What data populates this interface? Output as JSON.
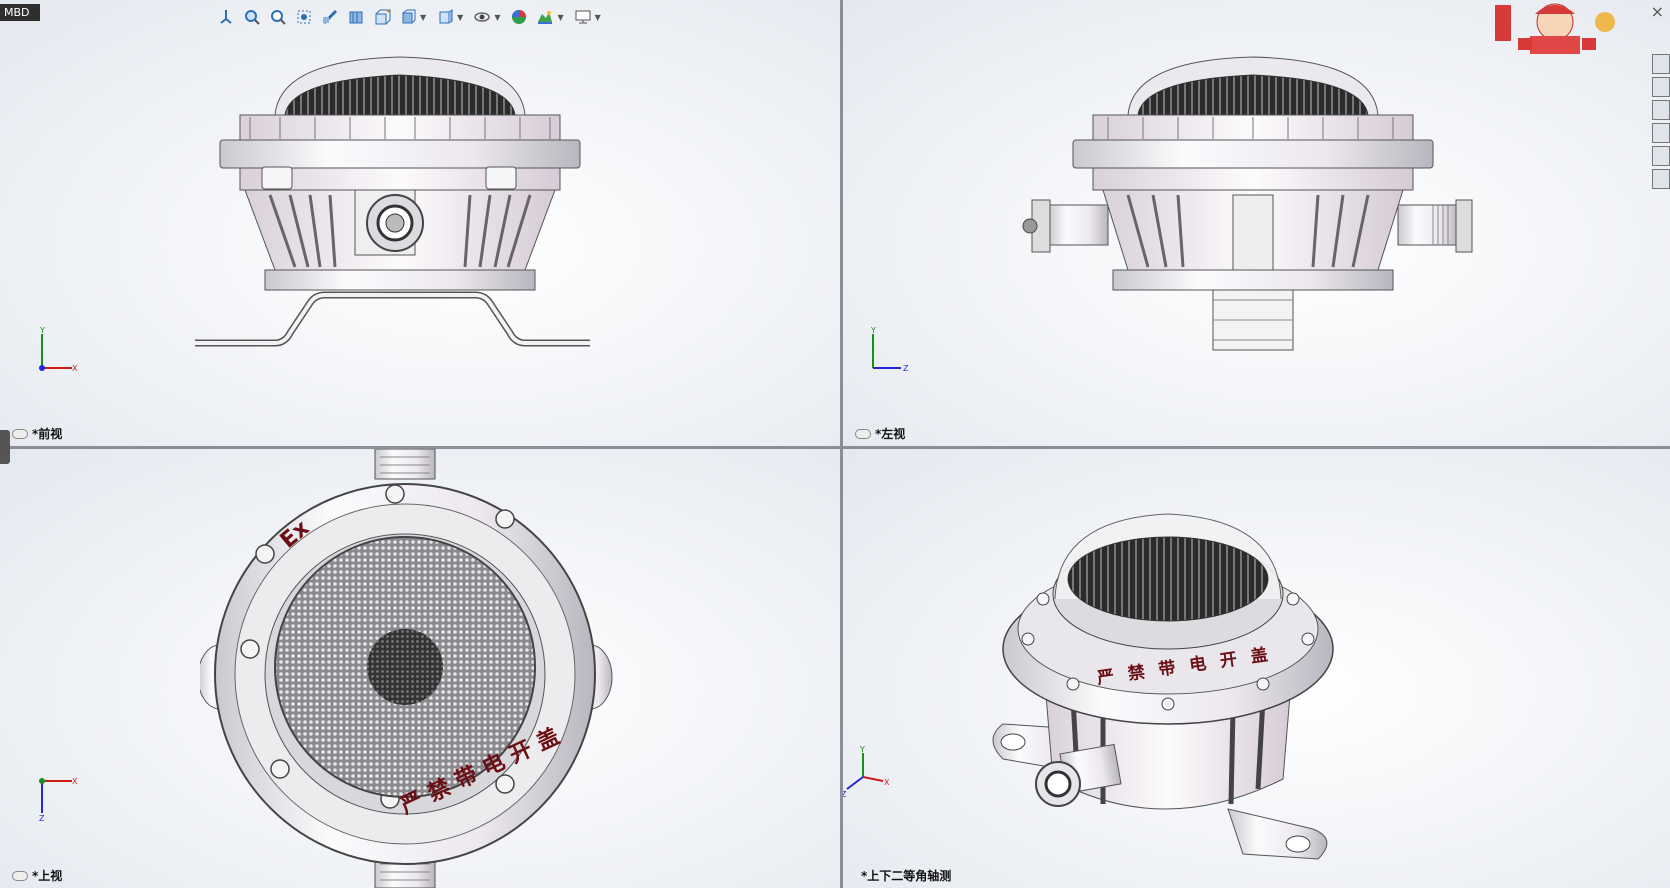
{
  "mbd_tab": "MBD",
  "views": {
    "front": "*前视",
    "left": "*左视",
    "top": "*上视",
    "iso": "*上下二等角轴测"
  },
  "axes": {
    "x": "X",
    "y": "Y",
    "z": "Z"
  },
  "engraving": {
    "ex": "Ex",
    "warning": "严禁带电开盖"
  },
  "icons": {
    "toolbar": [
      "view-orientation-icon",
      "zoom-to-fit-icon",
      "zoom-area-icon",
      "previous-view-icon",
      "section-view-icon",
      "dynamic-annotation-icon",
      "view-orientation-dropdown-icon",
      "display-style-icon",
      "hide-show-icon",
      "edit-appearance-icon",
      "apply-scene-icon",
      "view-settings-icon"
    ],
    "right_panel": [
      "home-icon",
      "parts-icon",
      "folder-icon",
      "palette-icon",
      "appearance-icon",
      "properties-icon"
    ]
  },
  "colors": {
    "engraving": "#6b0f14",
    "separator": "#8a8f97",
    "label_tab": "#2f2f2f"
  }
}
